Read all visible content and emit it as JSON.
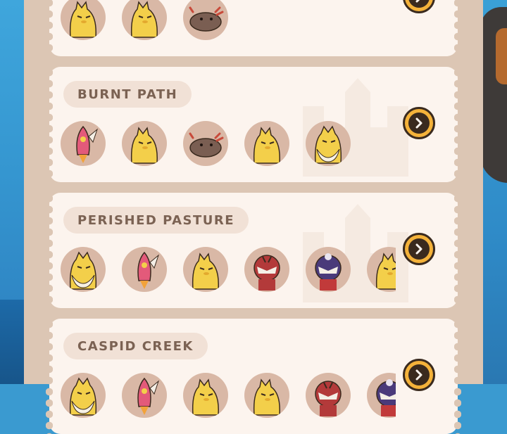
{
  "colors": {
    "panel": "#dcc6b4",
    "card": "#fcf4ee",
    "pill": "#f1e1d6",
    "title_text": "#7b6253",
    "button": "#f4b23a",
    "button_dark": "#3a2a1e",
    "avatar_bg": "#d9b8a6"
  },
  "areas": [
    {
      "title": "",
      "creatures": [
        "yellow-chick-creature",
        "yellow-chick-creature",
        "axolotl-creature"
      ]
    },
    {
      "title": "BURNT PATH",
      "creatures": [
        "rocket-creature",
        "yellow-chick-creature",
        "axolotl-creature",
        "yellow-chick-creature",
        "bearded-chick-creature"
      ]
    },
    {
      "title": "PERISHED PASTURE",
      "creatures": [
        "bearded-chick-creature",
        "rocket-creature",
        "yellow-chick-creature",
        "masked-red-creature",
        "masked-purple-creature",
        "yellow-chick-creature"
      ]
    },
    {
      "title": "CASPID CREEK",
      "creatures": [
        "bearded-chick-creature",
        "rocket-creature",
        "yellow-chick-creature",
        "yellow-chick-creature",
        "masked-red-creature",
        "masked-purple-creature"
      ]
    }
  ],
  "go_icon": "chevron-right-icon"
}
